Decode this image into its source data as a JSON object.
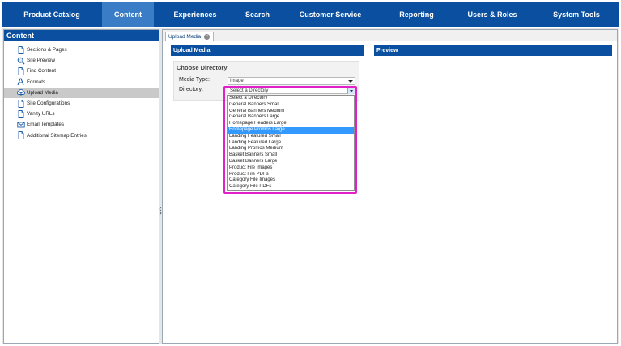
{
  "nav": {
    "items": [
      {
        "label": "Product Catalog",
        "active": false
      },
      {
        "label": "Content",
        "active": true
      },
      {
        "label": "Experiences",
        "active": false
      },
      {
        "label": "Search",
        "active": false
      },
      {
        "label": "Customer Service",
        "active": false
      },
      {
        "label": "Reporting",
        "active": false
      },
      {
        "label": "Users & Roles",
        "active": false
      },
      {
        "label": "System Tools",
        "active": false
      }
    ]
  },
  "sidebar": {
    "title": "Content",
    "items": [
      {
        "label": "Sections & Pages",
        "icon": "page-icon",
        "selected": false
      },
      {
        "label": "Site Preview",
        "icon": "search-icon",
        "selected": false
      },
      {
        "label": "Find Content",
        "icon": "page-icon",
        "selected": false
      },
      {
        "label": "Formats",
        "icon": "formats-icon",
        "selected": false
      },
      {
        "label": "Upload Media",
        "icon": "upload-icon",
        "selected": true
      },
      {
        "label": "Site Configurations",
        "icon": "page-icon",
        "selected": false
      },
      {
        "label": "Vanity URLs",
        "icon": "page-icon",
        "selected": false
      },
      {
        "label": "Email Templates",
        "icon": "email-icon",
        "selected": false
      },
      {
        "label": "Additional Sitemap Entries",
        "icon": "page-icon",
        "selected": false
      }
    ]
  },
  "main": {
    "tab_label": "Upload Media",
    "upload_header": "Upload Media",
    "choose_title": "Choose Directory",
    "media_type_label": "Media Type:",
    "media_type_value": "Image",
    "directory_label": "Directory:",
    "directory_value": "Select a Directory",
    "preview_header": "Preview"
  },
  "directory_options": [
    {
      "label": "Select a Directory",
      "selected": false
    },
    {
      "label": "General Banners Small",
      "selected": false
    },
    {
      "label": "General Banners Medium",
      "selected": false
    },
    {
      "label": "General Banners Large",
      "selected": false
    },
    {
      "label": "Homepage Headers Large",
      "selected": false
    },
    {
      "label": "Homepage Promos Large",
      "selected": true
    },
    {
      "label": "Landing Featured Small",
      "selected": false
    },
    {
      "label": "Landing Featured Large",
      "selected": false
    },
    {
      "label": "Landing Promos Medium",
      "selected": false
    },
    {
      "label": "Basket Banners Small",
      "selected": false
    },
    {
      "label": "Basket Banners Large",
      "selected": false
    },
    {
      "label": "Product File Images",
      "selected": false
    },
    {
      "label": "Product File PDFs",
      "selected": false
    },
    {
      "label": "Category File Images",
      "selected": false
    },
    {
      "label": "Category File PDFs",
      "selected": false
    }
  ],
  "colors": {
    "nav_bg": "#0a4fa0",
    "nav_active": "#3a7cc6",
    "highlight": "#e020c8",
    "selected_option": "#3399ff"
  }
}
